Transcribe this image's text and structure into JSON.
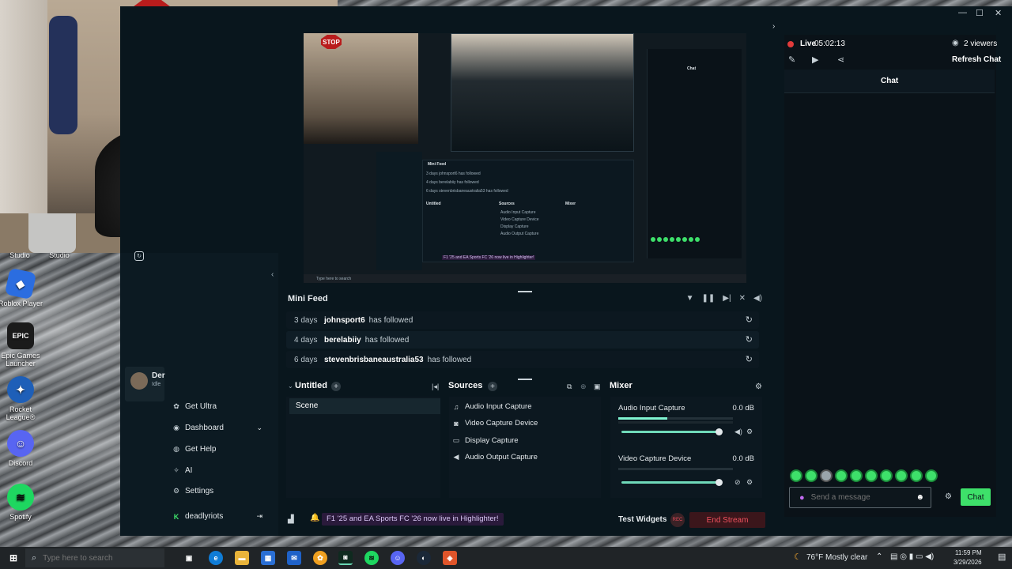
{
  "desktop": {
    "icons": [
      {
        "label_top": "Studio",
        "label_top2": "Studio"
      },
      {
        "label": "Roblox Player",
        "color": "#2b6de0"
      },
      {
        "label": "Epic Games Launcher",
        "icon_text": "EPIC",
        "color": "#1b1b1b"
      },
      {
        "label": "Rocket League®",
        "color": "#1e5fb8"
      },
      {
        "label": "Discord",
        "color": "#5865f2"
      },
      {
        "label": "Spotify",
        "color": "#1ed760"
      }
    ],
    "webcam_sign": "STOP"
  },
  "streamlabs": {
    "title_controls": [
      "—",
      "☐",
      "✕"
    ],
    "user_badge": {
      "name": "Der",
      "status": "Idle"
    },
    "menu": [
      {
        "label": "Get Ultra",
        "icon": "ultra-icon"
      },
      {
        "label": "Dashboard",
        "icon": "dashboard-icon"
      },
      {
        "label": "Get Help",
        "icon": "help-icon"
      },
      {
        "label": "AI",
        "icon": "ai-icon"
      },
      {
        "label": "Settings",
        "icon": "gear-icon"
      },
      {
        "label": "deadlyriots",
        "icon": "kick-icon"
      }
    ],
    "preview": {
      "nested_mini_feed": "Mini Feed",
      "nested_rows": [
        "3 days johnsport6 has followed",
        "4 days berelabiiy has followed",
        "6 days stevenbrisbaneaustralia53 has followed"
      ],
      "nested_panels": [
        "Untitled",
        "Sources",
        "Mixer"
      ],
      "nested_sources": [
        "Audio Input Capture",
        "Video Capture Device",
        "Display Capture",
        "Audio Output Capture"
      ],
      "nested_banner": "F1 '25 and EA Sports FC '26 now live in Highlighter!",
      "nested_search": "Type here to search",
      "nested_chat_title": "Chat"
    },
    "mini_feed": {
      "title": "Mini Feed",
      "rows": [
        {
          "ago": "3 days",
          "user": "johnsport6",
          "action": "has followed"
        },
        {
          "ago": "4 days",
          "user": "berelabiiy",
          "action": "has followed"
        },
        {
          "ago": "6 days",
          "user": "stevenbrisbaneaustralia53",
          "action": "has followed"
        }
      ]
    },
    "scenes": {
      "title": "Untitled",
      "items": [
        "Scene"
      ]
    },
    "sources": {
      "title": "Sources",
      "items": [
        {
          "label": "Audio Input Capture",
          "icon": "mic-icon"
        },
        {
          "label": "Video Capture Device",
          "icon": "camera-icon"
        },
        {
          "label": "Display Capture",
          "icon": "monitor-icon"
        },
        {
          "label": "Audio Output Capture",
          "icon": "speaker-icon"
        }
      ]
    },
    "mixer": {
      "title": "Mixer",
      "channels": [
        {
          "name": "Audio Input Capture",
          "db": "0.0 dB",
          "level": 0.43
        },
        {
          "name": "Video Capture Device",
          "db": "0.0 dB",
          "level": 0.0
        }
      ]
    },
    "footer": {
      "banner": "F1 '25 and EA Sports FC '26 now live in Highlighter!",
      "test_widgets": "Test Widgets",
      "rec": "REC",
      "end_stream": "End Stream"
    },
    "chat": {
      "live_label": "Live",
      "live_time": "05:02:13",
      "viewers": "2 viewers",
      "refresh": "Refresh Chat",
      "title": "Chat",
      "placeholder": "Send a message",
      "send": "Chat",
      "accent": "#3ee06a"
    }
  },
  "taskbar": {
    "search_placeholder": "Type here to search",
    "weather": "76°F  Mostly clear",
    "time": "11:59 PM",
    "date": "3/29/2026"
  }
}
